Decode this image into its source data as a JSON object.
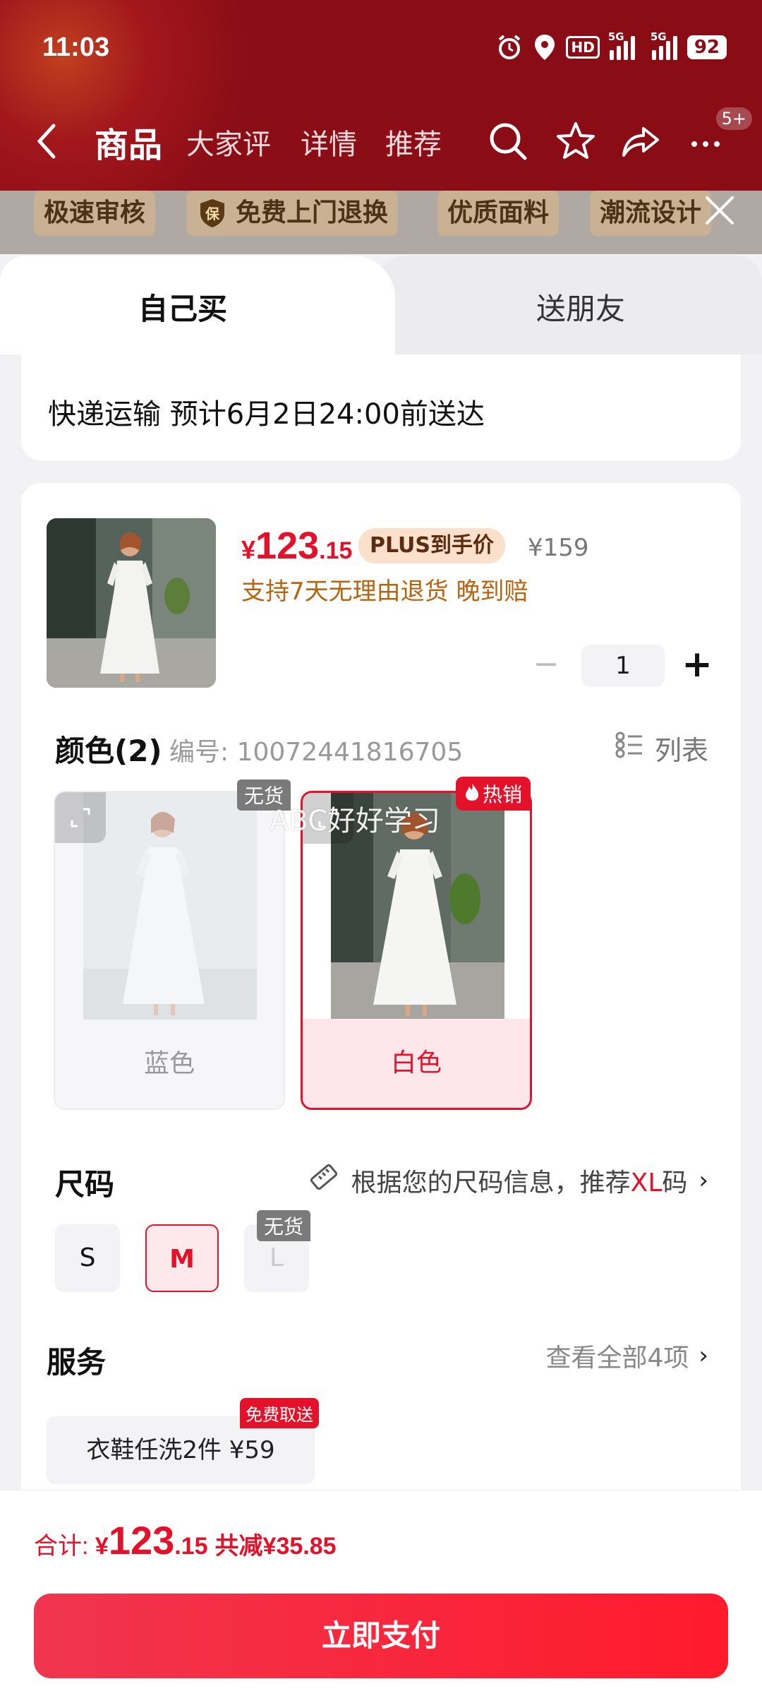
{
  "status_bar": {
    "time": "11:03",
    "battery": "92",
    "network1": "5G",
    "network2": "5G",
    "hd": "HD"
  },
  "nav": {
    "tabs": [
      "商品",
      "大家评",
      "详情",
      "推荐"
    ],
    "active": "商品",
    "badge": "5+"
  },
  "tags": [
    "极速审核",
    "免费上门退换",
    "优质面料",
    "潮流设计"
  ],
  "sheet": {
    "segments": {
      "self": "自己买",
      "friend": "送朋友"
    },
    "delivery": "快递运输 预计6月2日24:00前送达",
    "product": {
      "currency": "¥",
      "price_int": "123",
      "price_dec": ".15",
      "plus_label": "PLUS到手价",
      "original_price": "¥159",
      "refund": "支持7天无理由退货  晚到赔",
      "quantity": "1"
    },
    "color": {
      "title": "颜色(2)",
      "code": "编号: 10072441816705",
      "list_label": "列表",
      "options": [
        {
          "label": "蓝色",
          "badge": "无货",
          "selected": false
        },
        {
          "label": "白色",
          "badge": "热销",
          "selected": true
        }
      ],
      "watermark": "ABC好好学习"
    },
    "size": {
      "title": "尺码",
      "recommend_prefix": "根据您的尺码信息，推荐",
      "recommend_size": "XL",
      "recommend_suffix": "码",
      "options": [
        {
          "label": "S",
          "state": "normal"
        },
        {
          "label": "M",
          "state": "selected"
        },
        {
          "label": "L",
          "state": "disabled",
          "badge": "无货"
        }
      ]
    },
    "service": {
      "title": "服务",
      "view_all": "查看全部4项",
      "chip": "衣鞋任洗2件  ¥59",
      "chip_badge": "免费取送"
    }
  },
  "footer": {
    "total_label": "合计: ",
    "currency": "¥",
    "total_int": "123",
    "total_dec": ".15",
    "discount": "共减¥35.85",
    "pay_button": "立即支付"
  },
  "colors": {
    "accent": "#e3122a",
    "header_red": "#8b0d16",
    "plus_bg": "#fbe0cc"
  }
}
